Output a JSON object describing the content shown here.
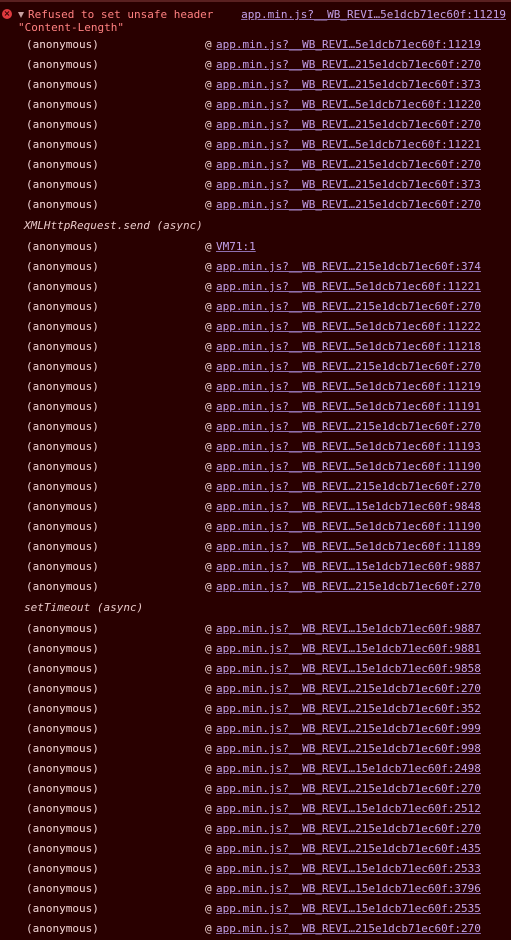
{
  "error": {
    "message_line1": "Refused to set unsafe header",
    "message_line2": "\"Content-Length\"",
    "source_link": "app.min.js?__WB_REVI…5e1dcb71ec60f:11219",
    "colors": {
      "background": "#290000",
      "error_text": "#ff8080",
      "link": "#c3a0e8",
      "icon": "#e0393e"
    },
    "icons": {
      "error": "error-circle-icon",
      "expand": "triangle-down-icon"
    }
  },
  "stack": [
    {
      "type": "frame",
      "fn": "(anonymous)",
      "at": "@",
      "loc": "app.min.js?__WB_REVI…5e1dcb71ec60f:11219"
    },
    {
      "type": "frame",
      "fn": "(anonymous)",
      "at": "@",
      "loc": "app.min.js?__WB_REVI…215e1dcb71ec60f:270"
    },
    {
      "type": "frame",
      "fn": "(anonymous)",
      "at": "@",
      "loc": "app.min.js?__WB_REVI…215e1dcb71ec60f:373"
    },
    {
      "type": "frame",
      "fn": "(anonymous)",
      "at": "@",
      "loc": "app.min.js?__WB_REVI…5e1dcb71ec60f:11220"
    },
    {
      "type": "frame",
      "fn": "(anonymous)",
      "at": "@",
      "loc": "app.min.js?__WB_REVI…215e1dcb71ec60f:270"
    },
    {
      "type": "frame",
      "fn": "(anonymous)",
      "at": "@",
      "loc": "app.min.js?__WB_REVI…5e1dcb71ec60f:11221"
    },
    {
      "type": "frame",
      "fn": "(anonymous)",
      "at": "@",
      "loc": "app.min.js?__WB_REVI…215e1dcb71ec60f:270"
    },
    {
      "type": "frame",
      "fn": "(anonymous)",
      "at": "@",
      "loc": "app.min.js?__WB_REVI…215e1dcb71ec60f:373"
    },
    {
      "type": "frame",
      "fn": "(anonymous)",
      "at": "@",
      "loc": "app.min.js?__WB_REVI…215e1dcb71ec60f:270"
    },
    {
      "type": "async",
      "label": "XMLHttpRequest.send (async)"
    },
    {
      "type": "frame",
      "fn": "(anonymous)",
      "at": "@",
      "loc": "VM71:1"
    },
    {
      "type": "frame",
      "fn": "(anonymous)",
      "at": "@",
      "loc": "app.min.js?__WB_REVI…215e1dcb71ec60f:374"
    },
    {
      "type": "frame",
      "fn": "(anonymous)",
      "at": "@",
      "loc": "app.min.js?__WB_REVI…5e1dcb71ec60f:11221"
    },
    {
      "type": "frame",
      "fn": "(anonymous)",
      "at": "@",
      "loc": "app.min.js?__WB_REVI…215e1dcb71ec60f:270"
    },
    {
      "type": "frame",
      "fn": "(anonymous)",
      "at": "@",
      "loc": "app.min.js?__WB_REVI…5e1dcb71ec60f:11222"
    },
    {
      "type": "frame",
      "fn": "(anonymous)",
      "at": "@",
      "loc": "app.min.js?__WB_REVI…5e1dcb71ec60f:11218"
    },
    {
      "type": "frame",
      "fn": "(anonymous)",
      "at": "@",
      "loc": "app.min.js?__WB_REVI…215e1dcb71ec60f:270"
    },
    {
      "type": "frame",
      "fn": "(anonymous)",
      "at": "@",
      "loc": "app.min.js?__WB_REVI…5e1dcb71ec60f:11219"
    },
    {
      "type": "frame",
      "fn": "(anonymous)",
      "at": "@",
      "loc": "app.min.js?__WB_REVI…5e1dcb71ec60f:11191"
    },
    {
      "type": "frame",
      "fn": "(anonymous)",
      "at": "@",
      "loc": "app.min.js?__WB_REVI…215e1dcb71ec60f:270"
    },
    {
      "type": "frame",
      "fn": "(anonymous)",
      "at": "@",
      "loc": "app.min.js?__WB_REVI…5e1dcb71ec60f:11193"
    },
    {
      "type": "frame",
      "fn": "(anonymous)",
      "at": "@",
      "loc": "app.min.js?__WB_REVI…5e1dcb71ec60f:11190"
    },
    {
      "type": "frame",
      "fn": "(anonymous)",
      "at": "@",
      "loc": "app.min.js?__WB_REVI…215e1dcb71ec60f:270"
    },
    {
      "type": "frame",
      "fn": "(anonymous)",
      "at": "@",
      "loc": "app.min.js?__WB_REVI…15e1dcb71ec60f:9848"
    },
    {
      "type": "frame",
      "fn": "(anonymous)",
      "at": "@",
      "loc": "app.min.js?__WB_REVI…5e1dcb71ec60f:11190"
    },
    {
      "type": "frame",
      "fn": "(anonymous)",
      "at": "@",
      "loc": "app.min.js?__WB_REVI…5e1dcb71ec60f:11189"
    },
    {
      "type": "frame",
      "fn": "(anonymous)",
      "at": "@",
      "loc": "app.min.js?__WB_REVI…15e1dcb71ec60f:9887"
    },
    {
      "type": "frame",
      "fn": "(anonymous)",
      "at": "@",
      "loc": "app.min.js?__WB_REVI…215e1dcb71ec60f:270"
    },
    {
      "type": "async",
      "label": "setTimeout (async)"
    },
    {
      "type": "frame",
      "fn": "(anonymous)",
      "at": "@",
      "loc": "app.min.js?__WB_REVI…15e1dcb71ec60f:9887"
    },
    {
      "type": "frame",
      "fn": "(anonymous)",
      "at": "@",
      "loc": "app.min.js?__WB_REVI…15e1dcb71ec60f:9881"
    },
    {
      "type": "frame",
      "fn": "(anonymous)",
      "at": "@",
      "loc": "app.min.js?__WB_REVI…15e1dcb71ec60f:9858"
    },
    {
      "type": "frame",
      "fn": "(anonymous)",
      "at": "@",
      "loc": "app.min.js?__WB_REVI…215e1dcb71ec60f:270"
    },
    {
      "type": "frame",
      "fn": "(anonymous)",
      "at": "@",
      "loc": "app.min.js?__WB_REVI…215e1dcb71ec60f:352"
    },
    {
      "type": "frame",
      "fn": "(anonymous)",
      "at": "@",
      "loc": "app.min.js?__WB_REVI…215e1dcb71ec60f:999"
    },
    {
      "type": "frame",
      "fn": "(anonymous)",
      "at": "@",
      "loc": "app.min.js?__WB_REVI…215e1dcb71ec60f:998"
    },
    {
      "type": "frame",
      "fn": "(anonymous)",
      "at": "@",
      "loc": "app.min.js?__WB_REVI…15e1dcb71ec60f:2498"
    },
    {
      "type": "frame",
      "fn": "(anonymous)",
      "at": "@",
      "loc": "app.min.js?__WB_REVI…215e1dcb71ec60f:270"
    },
    {
      "type": "frame",
      "fn": "(anonymous)",
      "at": "@",
      "loc": "app.min.js?__WB_REVI…15e1dcb71ec60f:2512"
    },
    {
      "type": "frame",
      "fn": "(anonymous)",
      "at": "@",
      "loc": "app.min.js?__WB_REVI…215e1dcb71ec60f:270"
    },
    {
      "type": "frame",
      "fn": "(anonymous)",
      "at": "@",
      "loc": "app.min.js?__WB_REVI…215e1dcb71ec60f:435"
    },
    {
      "type": "frame",
      "fn": "(anonymous)",
      "at": "@",
      "loc": "app.min.js?__WB_REVI…15e1dcb71ec60f:2533"
    },
    {
      "type": "frame",
      "fn": "(anonymous)",
      "at": "@",
      "loc": "app.min.js?__WB_REVI…15e1dcb71ec60f:3796"
    },
    {
      "type": "frame",
      "fn": "(anonymous)",
      "at": "@",
      "loc": "app.min.js?__WB_REVI…15e1dcb71ec60f:2535"
    },
    {
      "type": "frame",
      "fn": "(anonymous)",
      "at": "@",
      "loc": "app.min.js?__WB_REVI…215e1dcb71ec60f:270"
    }
  ]
}
